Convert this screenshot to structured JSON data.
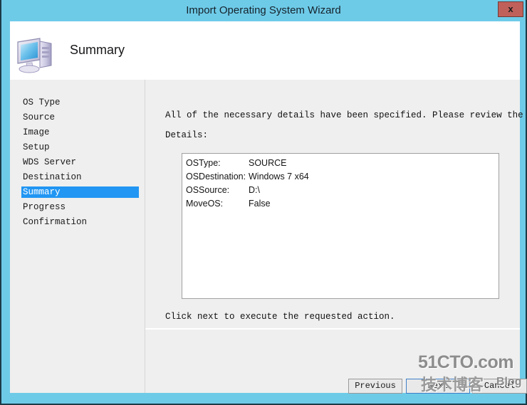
{
  "window": {
    "title": "Import Operating System Wizard",
    "close_label": "x",
    "titlebar_color": "#6ecbe8",
    "close_button_color": "#c0605a"
  },
  "header": {
    "page_title": "Summary",
    "icon": "computer-monitor-icon"
  },
  "sidebar": {
    "selected_index": 6,
    "selection_color": "#2196f3",
    "items": [
      {
        "label": "OS Type"
      },
      {
        "label": "Source"
      },
      {
        "label": "Image"
      },
      {
        "label": "Setup"
      },
      {
        "label": "WDS Server"
      },
      {
        "label": "Destination"
      },
      {
        "label": "Summary"
      },
      {
        "label": "Progress"
      },
      {
        "label": "Confirmation"
      }
    ]
  },
  "content": {
    "intro_text": "All of the necessary details have been specified.  Please review the values below.",
    "details_label": "Details:",
    "details_rows": [
      {
        "key": "OSType:",
        "value": "SOURCE"
      },
      {
        "key": "OSDestination:",
        "value": "Windows 7 x64"
      },
      {
        "key": "OSSource:",
        "value": "D:\\"
      },
      {
        "key": "MoveOS:",
        "value": "False"
      }
    ],
    "footer_text": "Click next to execute the requested action."
  },
  "buttons": {
    "previous": "Previous",
    "next": "Next",
    "cancel": "Cancel"
  },
  "watermark": {
    "line1": "51CTO.com",
    "line2": "技术博客",
    "line3": "Blog"
  }
}
